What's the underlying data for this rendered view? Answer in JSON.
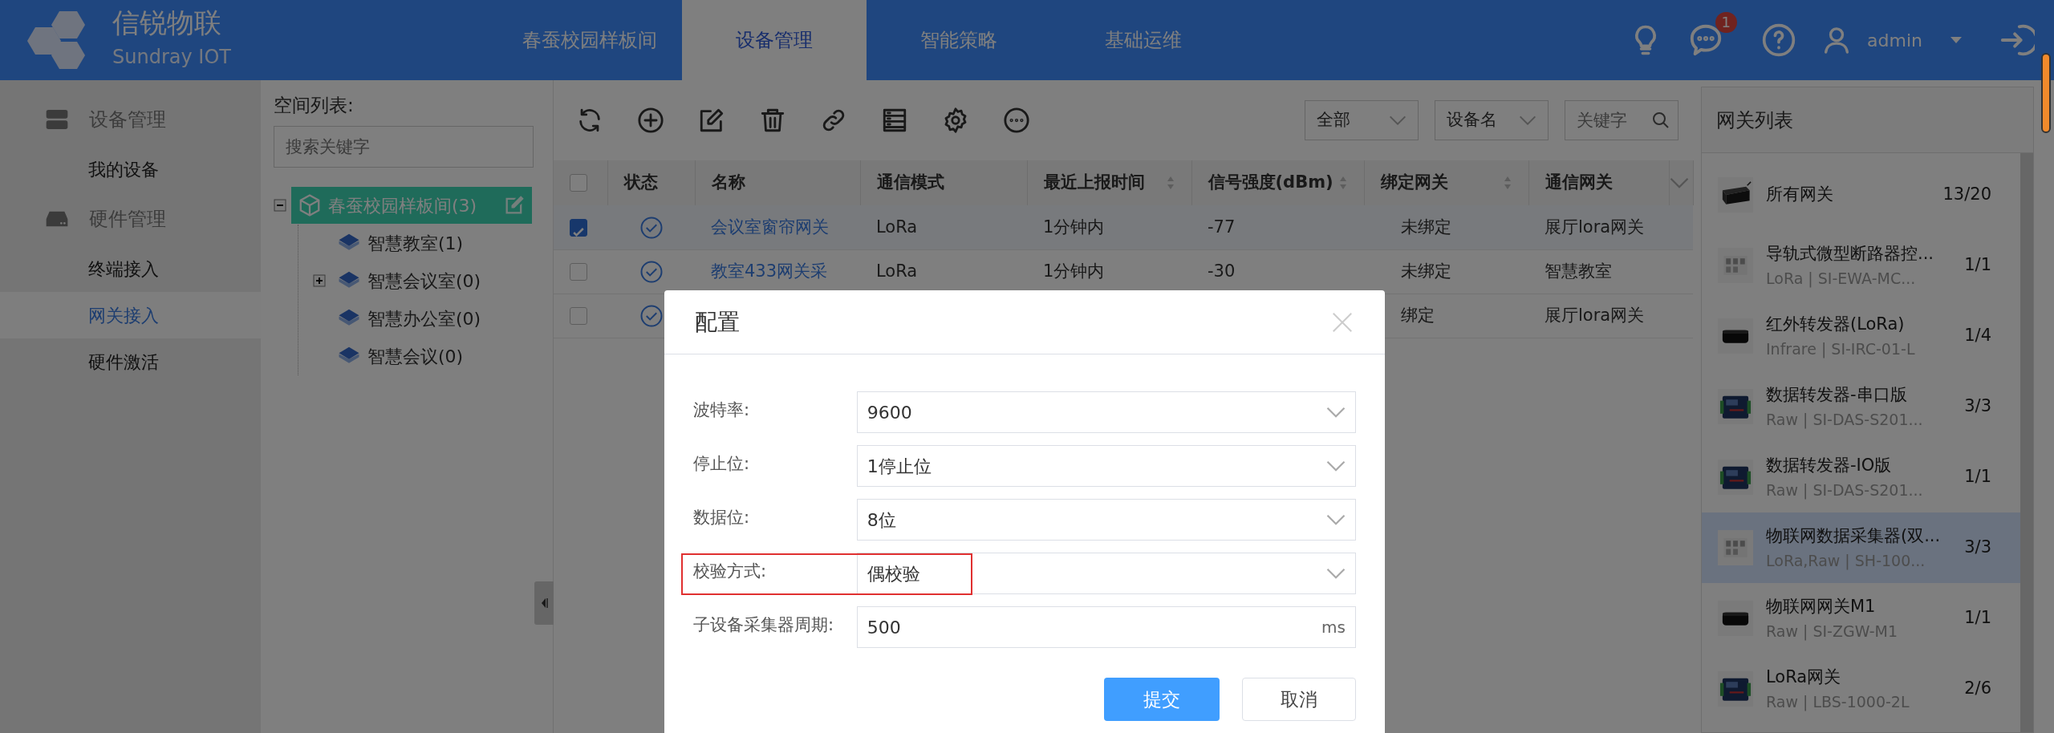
{
  "header": {
    "logo_title": "信锐物联",
    "logo_subtitle": "Sundray IOT",
    "nav": [
      {
        "label": "春蚕校园样板间",
        "selected": false
      },
      {
        "label": "设备管理",
        "selected": true
      },
      {
        "label": "智能策略",
        "selected": false
      },
      {
        "label": "基础运维",
        "selected": false
      }
    ],
    "notification_count": "1",
    "user": "admin"
  },
  "sidebar": {
    "groups": [
      {
        "label": "设备管理",
        "items": [
          {
            "label": "我的设备",
            "selected": false
          }
        ]
      },
      {
        "label": "硬件管理",
        "items": [
          {
            "label": "终端接入",
            "selected": false
          },
          {
            "label": "网关接入",
            "selected": true
          },
          {
            "label": "硬件激活",
            "selected": false
          }
        ]
      }
    ]
  },
  "space_tree": {
    "title": "空间列表:",
    "search": {
      "placeholder": "搜索关键字"
    },
    "nodes": [
      {
        "label": "春蚕校园样板间(3)",
        "selected": true,
        "expanded": true,
        "children": [
          {
            "label": "智慧教室(1)",
            "selected": false
          },
          {
            "label": "智慧会议室(0)",
            "selected": false,
            "expanded": false
          },
          {
            "label": "智慧办公室(0)",
            "selected": false
          },
          {
            "label": "智慧会议(0)",
            "selected": false
          }
        ]
      }
    ]
  },
  "filters": {
    "scope": "全部",
    "field": "设备名",
    "keyword": {
      "placeholder": "关键字"
    }
  },
  "table": {
    "all_selected": false,
    "columns": [
      {
        "label": "状态",
        "sortable": false
      },
      {
        "label": "名称",
        "sortable": false
      },
      {
        "label": "通信模式",
        "sortable": false
      },
      {
        "label": "最近上报时间",
        "sortable": true
      },
      {
        "label": "信号强度(dBm)",
        "sortable": true
      },
      {
        "label": "绑定网关",
        "sortable": true
      },
      {
        "label": "通信网关",
        "sortable": false
      }
    ],
    "rows": [
      {
        "selected": true,
        "online": true,
        "name": "会议室窗帘网关",
        "mode": "LoRa",
        "time": "1分钟内",
        "signal": "-77",
        "bound": "未绑定",
        "gateway": "展厅lora网关"
      },
      {
        "selected": false,
        "online": true,
        "name": "教室433网关采",
        "mode": "LoRa",
        "time": "1分钟内",
        "signal": "-30",
        "bound": "未绑定",
        "gateway": "智慧教室"
      },
      {
        "selected": false,
        "online": true,
        "bound": "绑定",
        "gateway": "展厅lora网关"
      }
    ]
  },
  "gateway_panel": {
    "title": "网关列表",
    "items": [
      {
        "name": "所有网关",
        "count": "13/20",
        "selected": false
      },
      {
        "name": "导轨式微型断路器控...",
        "subtitle": "LoRa | SI-EWA-MC...",
        "count": "1/1",
        "selected": false
      },
      {
        "name": "红外转发器(LoRa)",
        "subtitle": "Infrare | SI-IRC-01-L",
        "count": "1/4",
        "selected": false
      },
      {
        "name": "数据转发器-串口版",
        "subtitle": "Raw | SI-DAS-S201...",
        "count": "3/3",
        "selected": false
      },
      {
        "name": "数据转发器-IO版",
        "subtitle": "Raw | SI-DAS-S201...",
        "count": "1/1",
        "selected": false
      },
      {
        "name": "物联网数据采集器(双...",
        "subtitle": "LoRa,Raw | SH-100...",
        "count": "3/3",
        "selected": true
      },
      {
        "name": "物联网网关M1",
        "subtitle": "Raw | SI-ZGW-M1",
        "count": "1/1",
        "selected": false
      },
      {
        "name": "LoRa网关",
        "subtitle": "Raw | LBS-1000-2L",
        "count": "2/6",
        "selected": false
      }
    ]
  },
  "dialog": {
    "title": "配置",
    "fields": [
      {
        "label": "波特率:",
        "kind": "select",
        "value": "9600",
        "highlighted": false
      },
      {
        "label": "停止位:",
        "kind": "select",
        "value": "1停止位",
        "highlighted": false
      },
      {
        "label": "数据位:",
        "kind": "select",
        "value": "8位",
        "highlighted": false
      },
      {
        "label": "校验方式:",
        "kind": "select",
        "value": "偶校验",
        "highlighted": true
      },
      {
        "label": "子设备采集器周期:",
        "kind": "input",
        "value": "500",
        "unit": "ms",
        "highlighted": false
      }
    ],
    "buttons": [
      {
        "label": "提交",
        "kind": "primary"
      },
      {
        "label": "取消",
        "kind": "secondary"
      }
    ]
  }
}
